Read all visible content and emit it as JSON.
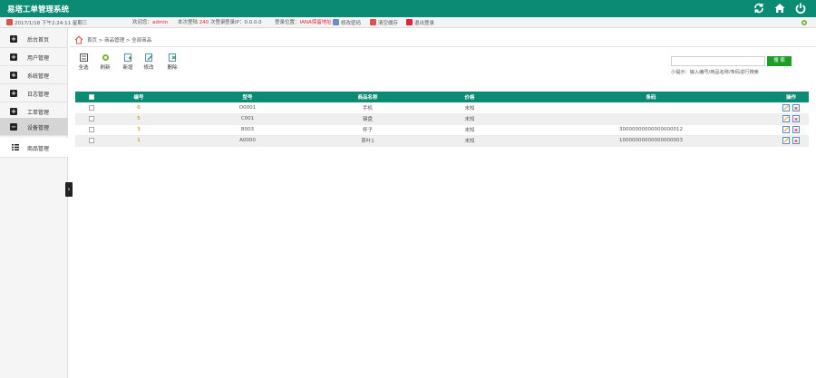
{
  "app": {
    "title": "易塔工单管理系统"
  },
  "topbar_icons": [
    "refresh-icon",
    "home-icon",
    "power-icon"
  ],
  "infobar": {
    "date": "2017/1/18 下午2:24:11 星期三",
    "welcome_prefix": "欢迎您：",
    "user": "admin",
    "login_prefix": "本次登陆",
    "login_count": "240",
    "login_suffix": "次登录",
    "ip": "登录IP：0.0.0.0",
    "location_prefix": "登录位置：",
    "location": "IANA保留地址",
    "change_password": "修改密码",
    "clear_cache": "清空缓存",
    "safe_exit": "退出登录"
  },
  "sidebar": {
    "items": [
      {
        "label": "后台首页",
        "icon": "plus-square-icon"
      },
      {
        "label": "用户管理",
        "icon": "plus-square-icon"
      },
      {
        "label": "系统管理",
        "icon": "plus-square-icon"
      },
      {
        "label": "日志管理",
        "icon": "plus-square-icon"
      },
      {
        "label": "工单管理",
        "icon": "plus-square-icon"
      },
      {
        "label": "设备管理",
        "icon": "minus-square-icon"
      },
      {
        "label": "商品管理",
        "icon": "list-icon"
      }
    ],
    "active_index": 5
  },
  "breadcrumb": {
    "home": "首页",
    "sep": ">",
    "section": "商品管理",
    "page": "全部商品"
  },
  "toolbar": [
    {
      "label": "全选",
      "icon": "select-all-icon"
    },
    {
      "label": "刷新",
      "icon": "refresh-icon"
    },
    {
      "label": "新增",
      "icon": "add-icon"
    },
    {
      "label": "修改",
      "icon": "edit-icon"
    },
    {
      "label": "删除",
      "icon": "delete-icon"
    }
  ],
  "search": {
    "placeholder": "",
    "button": "搜 索",
    "hint": "小提示：输入编号/商品名称/条码进行搜索"
  },
  "table": {
    "columns": [
      "",
      "编号",
      "型号",
      "商品名称",
      "价格",
      "条码",
      "操作"
    ],
    "rows": [
      {
        "id": "6",
        "model": "D0001",
        "name": "手机",
        "price": "未知",
        "barcode": ""
      },
      {
        "id": "5",
        "model": "C001",
        "name": "键盘",
        "price": "未知",
        "barcode": ""
      },
      {
        "id": "3",
        "model": "B003",
        "name": "杯子",
        "price": "未知",
        "barcode": "30000000000000000012"
      },
      {
        "id": "1",
        "model": "A0000",
        "name": "茶叶1",
        "price": "未知",
        "barcode": "10000000000000000003"
      }
    ]
  },
  "colors": {
    "brand": "#0b8b74",
    "search_button": "#1e9e28",
    "highlight": "#e0223b",
    "id_text": "#c47e00"
  }
}
